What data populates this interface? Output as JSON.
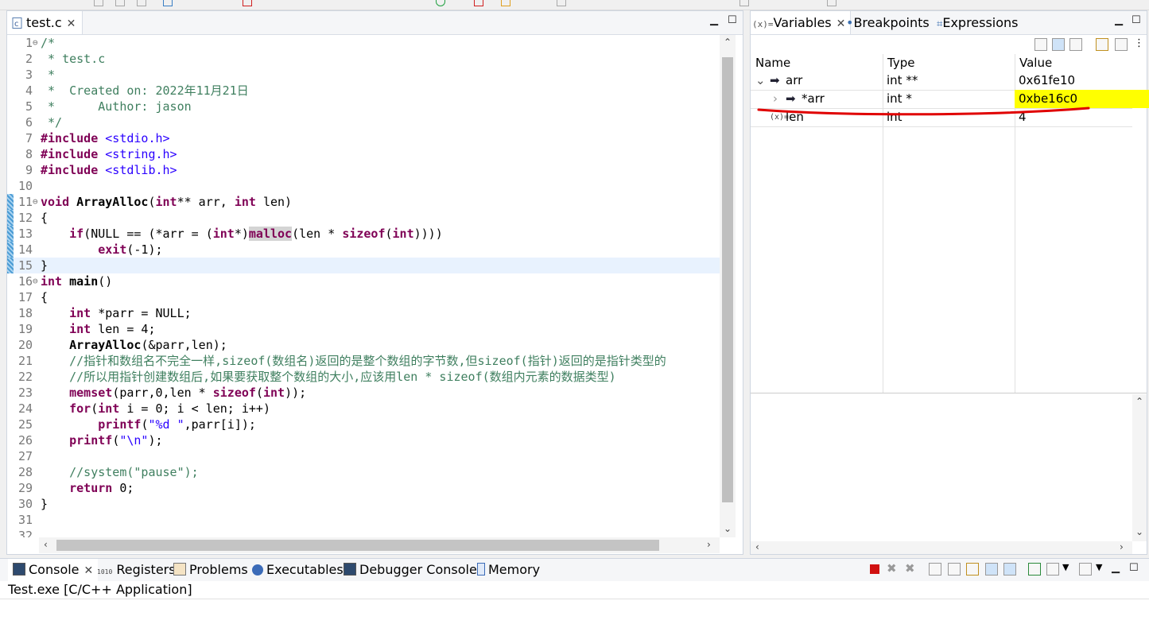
{
  "editor": {
    "tab_label": "test.c",
    "lines": [
      {
        "n": "1",
        "fold": "⊖",
        "t": "/*"
      },
      {
        "n": "2",
        "t": " * test.c"
      },
      {
        "n": "3",
        "t": " *"
      },
      {
        "n": "4",
        "t": " *  Created on: 2022年11月21日"
      },
      {
        "n": "5",
        "t": " *      Author: jason"
      },
      {
        "n": "6",
        "t": " */"
      },
      {
        "n": "7",
        "t": "#include <stdio.h>"
      },
      {
        "n": "8",
        "t": "#include <string.h>"
      },
      {
        "n": "9",
        "t": "#include <stdlib.h>"
      },
      {
        "n": "10",
        "t": ""
      },
      {
        "n": "11",
        "fold": "⊖",
        "t": "void ArrayAlloc(int** arr, int len)"
      },
      {
        "n": "12",
        "t": "{"
      },
      {
        "n": "13",
        "t": "    if(NULL == (*arr = (int*)malloc(len * sizeof(int))))"
      },
      {
        "n": "14",
        "t": "        exit(-1);"
      },
      {
        "n": "15",
        "t": "}"
      },
      {
        "n": "16",
        "fold": "⊖",
        "t": "int main()"
      },
      {
        "n": "17",
        "t": "{"
      },
      {
        "n": "18",
        "t": "    int *parr = NULL;"
      },
      {
        "n": "19",
        "t": "    int len = 4;"
      },
      {
        "n": "20",
        "t": "    ArrayAlloc(&parr,len);"
      },
      {
        "n": "21",
        "t": "    //指针和数组名不完全一样,sizeof(数组名)返回的是整个数组的字节数,但sizeof(指针)返回的是指针类型的"
      },
      {
        "n": "22",
        "t": "    //所以用指针创建数组后,如果要获取整个数组的大小,应该用len * sizeof(数组内元素的数据类型)"
      },
      {
        "n": "23",
        "t": "    memset(parr,0,len * sizeof(int));"
      },
      {
        "n": "24",
        "t": "    for(int i = 0; i < len; i++)"
      },
      {
        "n": "25",
        "t": "        printf(\"%d \",parr[i]);"
      },
      {
        "n": "26",
        "t": "    printf(\"\\n\");"
      },
      {
        "n": "27",
        "t": ""
      },
      {
        "n": "28",
        "t": "    //system(\"pause\");"
      },
      {
        "n": "29",
        "t": "    return 0;"
      },
      {
        "n": "30",
        "t": "}"
      },
      {
        "n": "31",
        "t": ""
      },
      {
        "n": "32",
        "t": ""
      }
    ]
  },
  "variables_panel": {
    "tabs": [
      "Variables",
      "Breakpoints",
      "Expressions"
    ],
    "columns": [
      "Name",
      "Type",
      "Value"
    ],
    "rows": [
      {
        "name": "arr",
        "type": "int **",
        "value": "0x61fe10",
        "expander": "⌄"
      },
      {
        "name": "*arr",
        "type": "int *",
        "value": "0xbe16c0",
        "expander": "›"
      },
      {
        "name": "len",
        "type": "int",
        "value": "4",
        "expander": ""
      }
    ],
    "highlight_color": "#ffff00",
    "annotation_color": "#e00000"
  },
  "console_panel": {
    "tabs": [
      "Console",
      "Registers",
      "Problems",
      "Executables",
      "Debugger Console",
      "Memory"
    ],
    "title": "Test.exe [C/C++ Application]"
  },
  "icons": {
    "file": "c-file-icon",
    "variables": "variables-icon",
    "breakpoints": "breakpoints-icon",
    "expressions": "expressions-icon"
  }
}
